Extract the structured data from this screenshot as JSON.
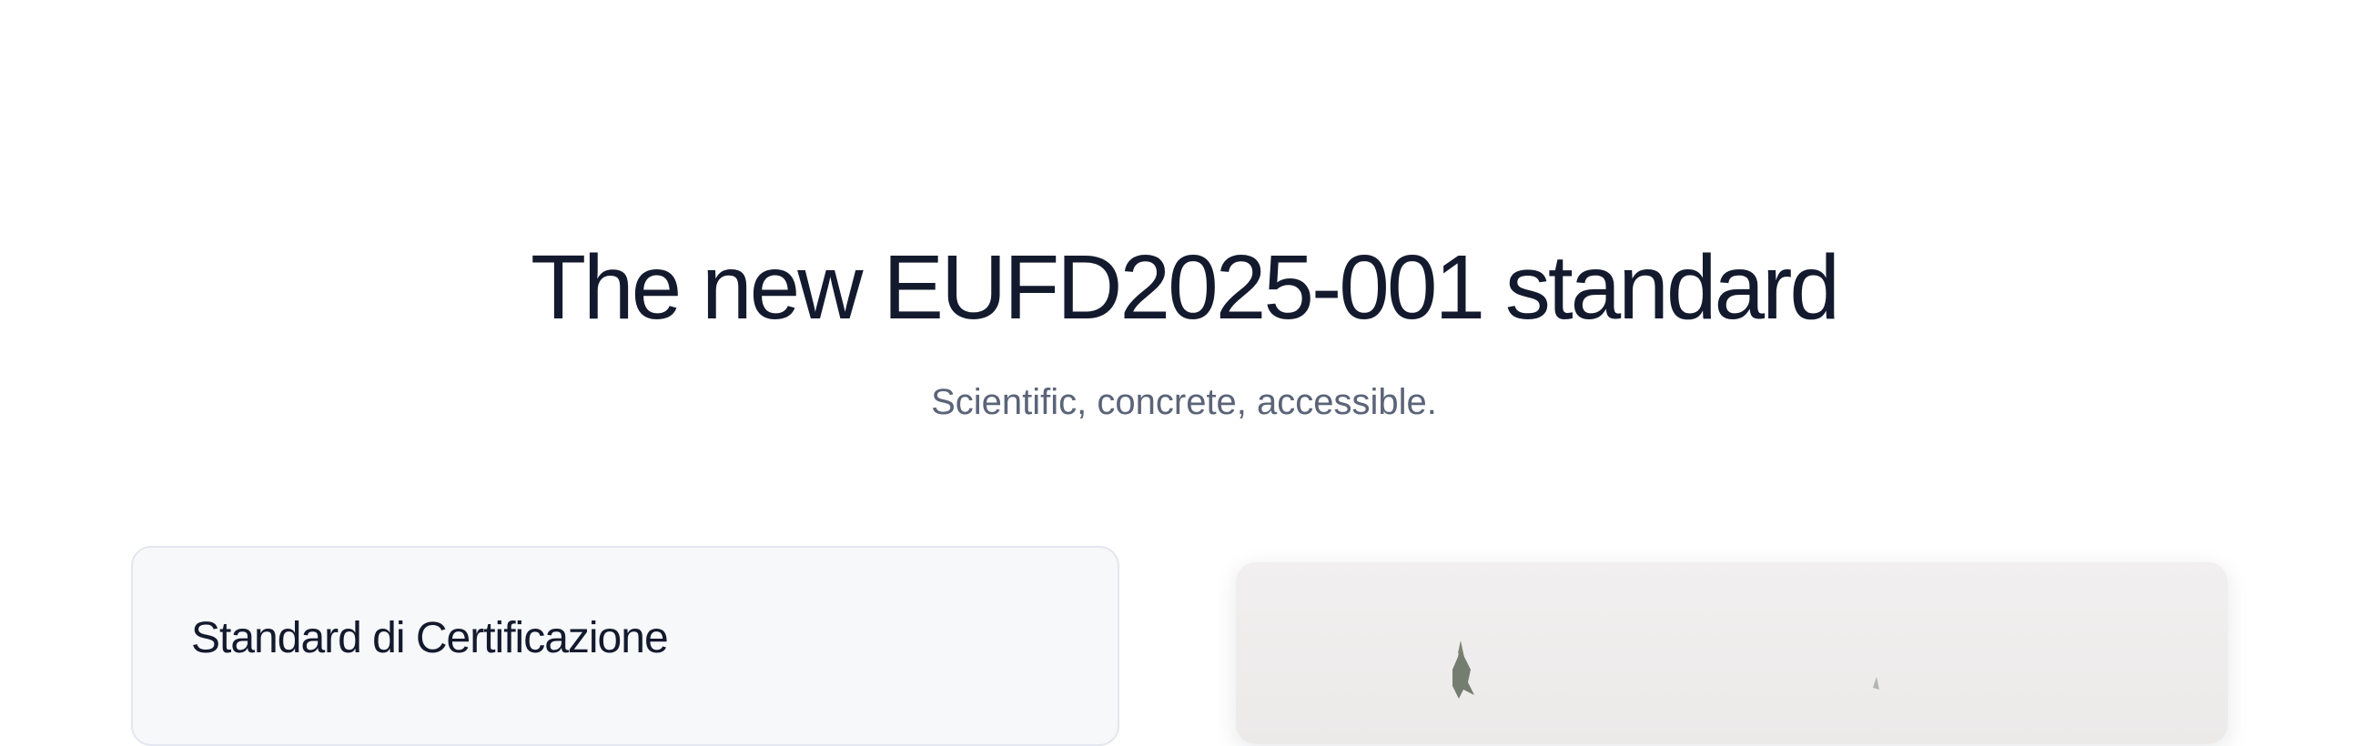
{
  "hero": {
    "title": "The new EUFD2025-001 standard",
    "subtitle": "Scientific, concrete, accessible."
  },
  "certification_card": {
    "title": "Standard di Certificazione"
  },
  "colors": {
    "title_text": "#141a2e",
    "subtitle_text": "#5b6478",
    "card_background": "#f7f8fa",
    "card_border": "#e3e6ee",
    "photo_background": "#efecec"
  }
}
